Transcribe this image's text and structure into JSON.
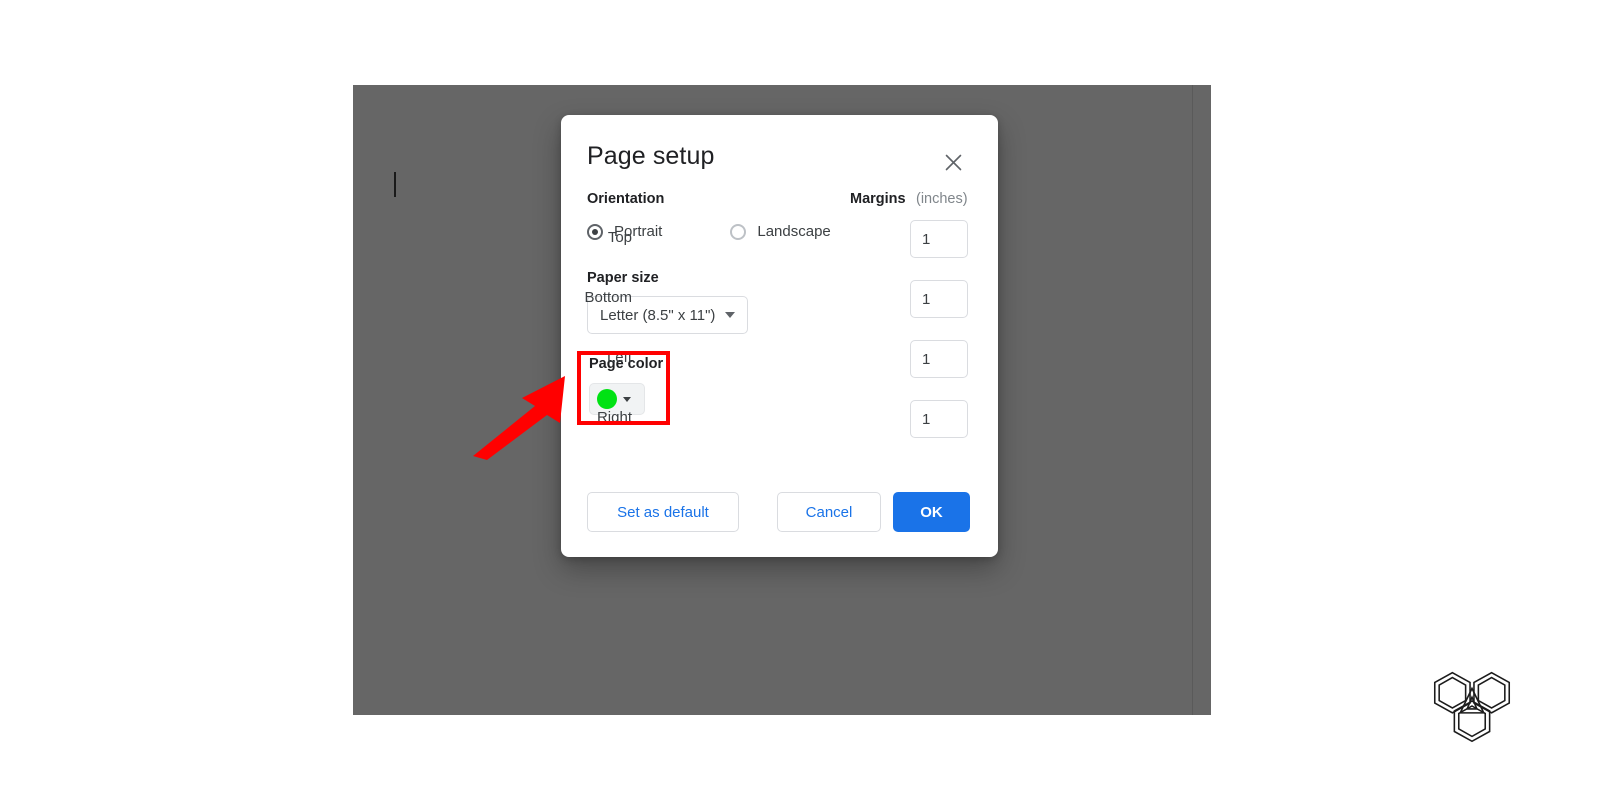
{
  "document": {
    "backdrop_color": "#666666",
    "caret_visible": true
  },
  "dialog": {
    "title": "Page setup",
    "close_icon": "close-icon",
    "orientation": {
      "label": "Orientation",
      "options": [
        {
          "label": "Portrait",
          "selected": true
        },
        {
          "label": "Landscape",
          "selected": false
        }
      ]
    },
    "paper_size": {
      "label": "Paper size",
      "value": "Letter (8.5\" x 11\")",
      "dropdown_icon": "chevron-down-icon"
    },
    "page_color": {
      "label": "Page color",
      "value_hex": "#00E213",
      "dropdown_icon": "chevron-down-icon"
    },
    "margins": {
      "label": "Margins",
      "unit_label": "(inches)",
      "fields": [
        {
          "label": "Top",
          "value": "1"
        },
        {
          "label": "Bottom",
          "value": "1"
        },
        {
          "label": "Left",
          "value": "1"
        },
        {
          "label": "Right",
          "value": "1"
        }
      ]
    },
    "footer": {
      "set_default_label": "Set as default",
      "cancel_label": "Cancel",
      "ok_label": "OK",
      "primary_color": "#1a73e8",
      "link_color": "#1a73e8"
    }
  },
  "annotations": {
    "highlight_color": "#ff0000",
    "arrow_color": "#ff0000",
    "highlight_target": "page-color"
  },
  "watermark": {
    "glyph": "three-hexagons-a-logo"
  }
}
